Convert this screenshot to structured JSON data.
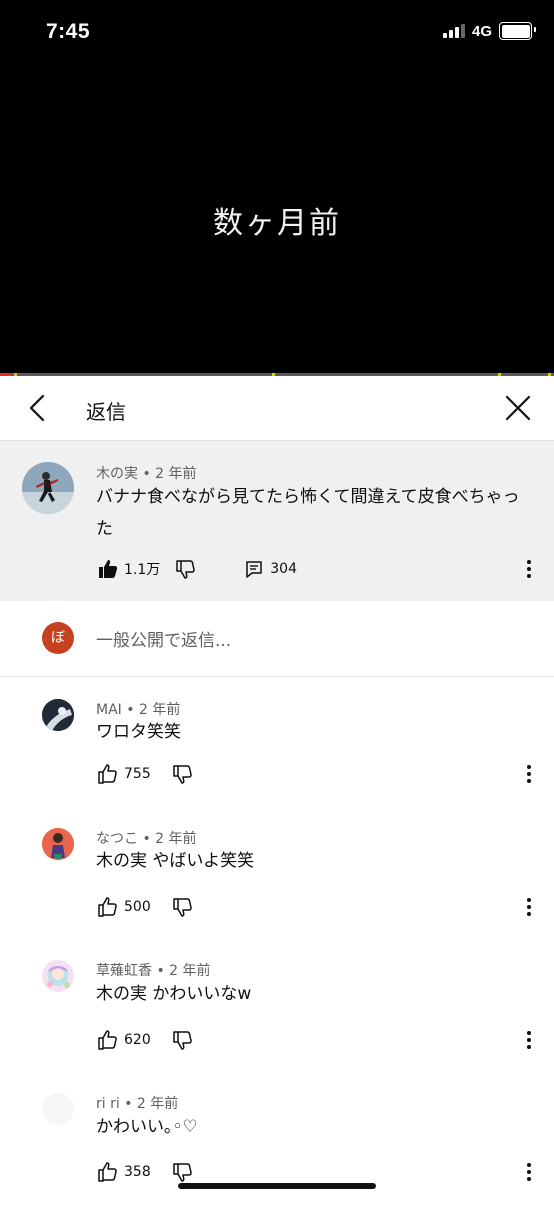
{
  "status": {
    "time": "7:45",
    "network": "4G"
  },
  "video": {
    "caption": "数ヶ月前",
    "progress_percent": 2
  },
  "header": {
    "title": "返信"
  },
  "parent_comment": {
    "author": "木の実",
    "time": "2 年前",
    "text": "バナナ食べながら見てたら怖くて間違えて皮食べちゃった",
    "likes": "1.1万",
    "replies": "304"
  },
  "compose": {
    "avatar_letter": "ぼ",
    "placeholder": "一般公開で返信..."
  },
  "replies": [
    {
      "author": "MAI",
      "time": "2 年前",
      "text": "ワロタ笑笑",
      "likes": "755"
    },
    {
      "author": "なつこ",
      "time": "2 年前",
      "text": "木の実 やばいよ笑笑",
      "likes": "500"
    },
    {
      "author": "草薙虹香",
      "time": "2 年前",
      "text": "木の実 かわいいなw",
      "likes": "620"
    },
    {
      "author": "ri ri",
      "time": "2 年前",
      "text": "かわいい｡◦♡",
      "likes": "358"
    }
  ],
  "separator": " • "
}
